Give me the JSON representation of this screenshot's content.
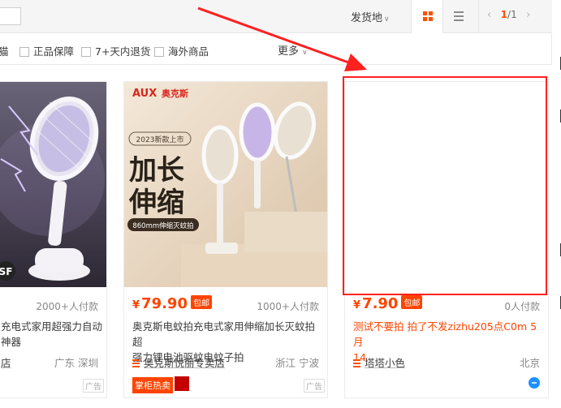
{
  "sortbar": {
    "ship_from": "发货地",
    "page_current": "1",
    "page_total": "1",
    "prev_arrow": "‹",
    "next_arrow": "›"
  },
  "filters": {
    "partial": "猫",
    "items": [
      "正品保障",
      "7+天内退货",
      "海外商品"
    ],
    "more": "更多"
  },
  "products": [
    {
      "price": "",
      "sales": "2000+人付款",
      "title_lines": [
        "充电式家用超强力自动",
        "神器"
      ],
      "shop": "店",
      "location": "广东 深圳",
      "ad": "广告",
      "image_badge": "SF"
    },
    {
      "price": "79.90",
      "price_symbol": "¥",
      "free_ship": "包邮",
      "sales": "1000+人付款",
      "title_lines": [
        "奥克斯电蚊拍充电式家用伸缩加长灭蚊拍超",
        "强力锂电池驱蚊电蚊子拍"
      ],
      "shop": "奥克斯悦丽专卖店",
      "location": "浙江 宁波",
      "tag_hot": "掌柜热卖",
      "ad": "广告",
      "image": {
        "brand": "AUX",
        "brand_cn": "奥克斯",
        "tagline": "2023新款上市",
        "headline_1": "加长",
        "headline_2": "伸缩",
        "pill": "860mm伸缩灭蚊拍"
      }
    },
    {
      "price": "7.90",
      "price_symbol": "¥",
      "free_ship": "包邮",
      "sales": "0人付款",
      "title_lines": [
        "测试不要拍 拍了不发zizhu205点C0m 5月",
        "14"
      ],
      "shop": "塔塔小色",
      "location": "北京"
    }
  ],
  "colors": {
    "accent": "#ff5000",
    "price": "#ff4400",
    "annotation": "#ff2020"
  }
}
